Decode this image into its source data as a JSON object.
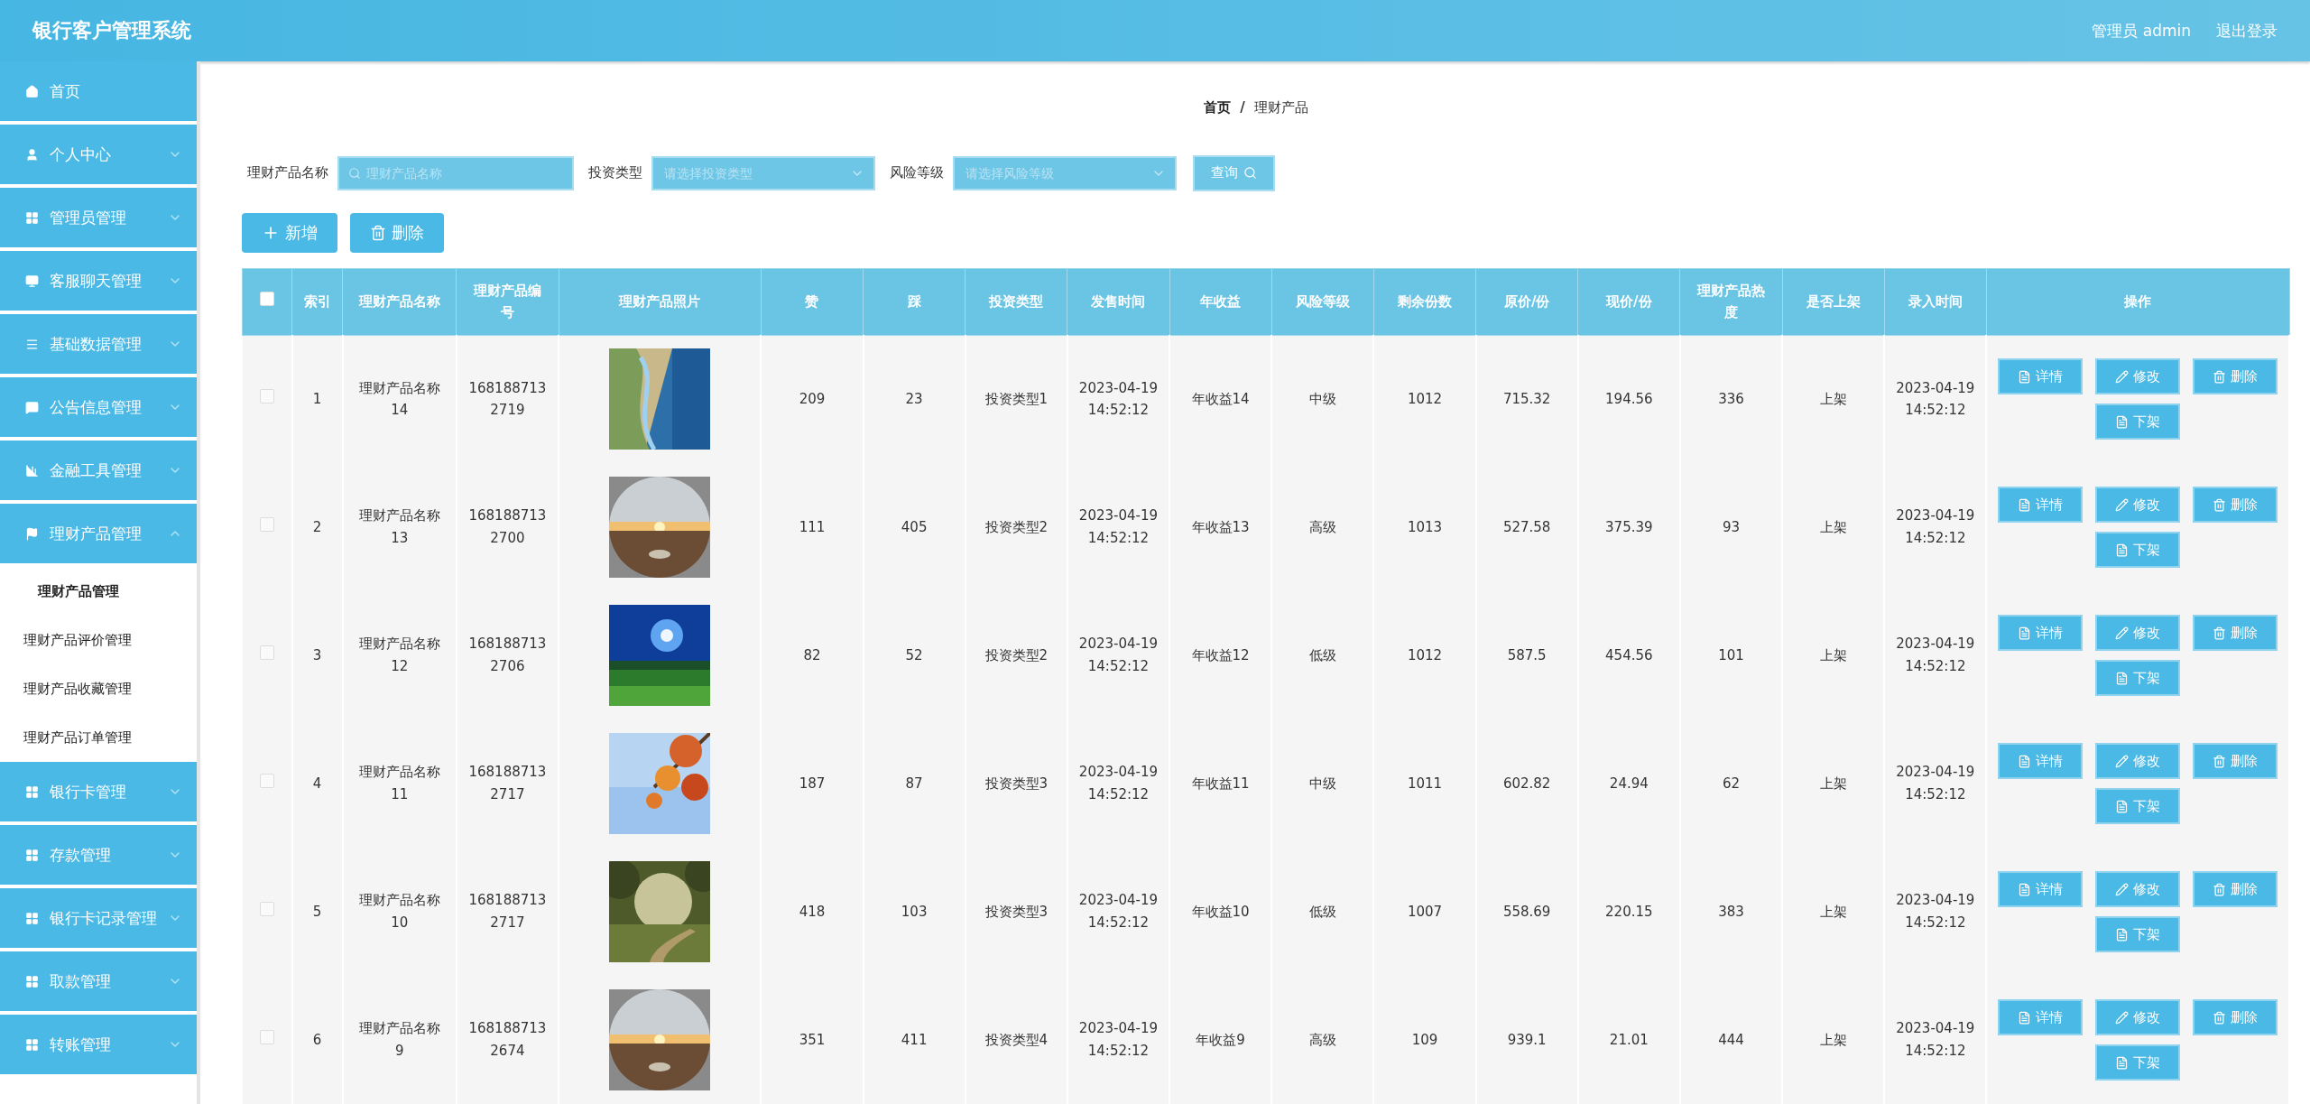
{
  "header": {
    "title": "银行客户管理系统",
    "user": "管理员 admin",
    "logout": "退出登录"
  },
  "sidebar": {
    "items": [
      {
        "label": "首页"
      },
      {
        "label": "个人中心",
        "expanded": false
      },
      {
        "label": "管理员管理",
        "expanded": false
      },
      {
        "label": "客服聊天管理",
        "expanded": false
      },
      {
        "label": "基础数据管理",
        "expanded": false
      },
      {
        "label": "公告信息管理",
        "expanded": false
      },
      {
        "label": "金融工具管理",
        "expanded": false
      },
      {
        "label": "理财产品管理",
        "expanded": true,
        "children": [
          {
            "label": "理财产品管理",
            "selected": true
          },
          {
            "label": "理财产品评价管理",
            "selected": false
          },
          {
            "label": "理财产品收藏管理",
            "selected": false
          },
          {
            "label": "理财产品订单管理",
            "selected": false
          }
        ]
      },
      {
        "label": "银行卡管理",
        "expanded": false
      },
      {
        "label": "存款管理",
        "expanded": false
      },
      {
        "label": "银行卡记录管理",
        "expanded": false
      },
      {
        "label": "取款管理",
        "expanded": false
      },
      {
        "label": "转账管理",
        "expanded": false
      }
    ]
  },
  "breadcrumb": {
    "items": [
      "首页",
      "理财产品"
    ],
    "separator": "/"
  },
  "filters": [
    {
      "kind": "text",
      "label": "理财产品名称",
      "placeholder": "理财产品名称"
    },
    {
      "kind": "select",
      "label": "投资类型",
      "placeholder": "请选择投资类型"
    },
    {
      "kind": "select",
      "label": "风险等级",
      "placeholder": "请选择风险等级"
    }
  ],
  "search_button": "查询",
  "actions": [
    {
      "kind": "add",
      "label": "新增"
    },
    {
      "kind": "delete",
      "label": "删除"
    }
  ],
  "table": {
    "select_all": false,
    "columns": [
      "索引",
      "理财产品名称",
      "理财产品编号",
      "理财产品照片",
      "赞",
      "踩",
      "投资类型",
      "发售时间",
      "年收益",
      "风险等级",
      "剩余份数",
      "原价/份",
      "现价/份",
      "理财产品热度",
      "是否上架",
      "录入时间",
      "操作"
    ],
    "rows": [
      {
        "checked": false,
        "cells": [
          "1",
          "理财产品名称14",
          "1681887132719",
          null,
          "209",
          "23",
          "投资类型1",
          "2023-04-19 14:52:12",
          "年收益14",
          "中级",
          "1012",
          "715.32",
          "194.56",
          "336",
          "上架",
          "2023-04-19 14:52:12"
        ],
        "buttons": [
          {
            "kind": "detail",
            "label": "详情"
          },
          {
            "kind": "edit",
            "label": "修改"
          },
          {
            "kind": "delete",
            "label": "删除"
          },
          {
            "kind": "offshelf",
            "label": "下架"
          }
        ]
      },
      {
        "checked": false,
        "cells": [
          "2",
          "理财产品名称13",
          "1681887132700",
          null,
          "111",
          "405",
          "投资类型2",
          "2023-04-19 14:52:12",
          "年收益13",
          "高级",
          "1013",
          "527.58",
          "375.39",
          "93",
          "上架",
          "2023-04-19 14:52:12"
        ],
        "buttons": [
          {
            "kind": "detail",
            "label": "详情"
          },
          {
            "kind": "edit",
            "label": "修改"
          },
          {
            "kind": "delete",
            "label": "删除"
          },
          {
            "kind": "offshelf",
            "label": "下架"
          }
        ]
      },
      {
        "checked": false,
        "cells": [
          "3",
          "理财产品名称12",
          "1681887132706",
          null,
          "82",
          "52",
          "投资类型2",
          "2023-04-19 14:52:12",
          "年收益12",
          "低级",
          "1012",
          "587.5",
          "454.56",
          "101",
          "上架",
          "2023-04-19 14:52:12"
        ],
        "buttons": [
          {
            "kind": "detail",
            "label": "详情"
          },
          {
            "kind": "edit",
            "label": "修改"
          },
          {
            "kind": "delete",
            "label": "删除"
          },
          {
            "kind": "offshelf",
            "label": "下架"
          }
        ]
      },
      {
        "checked": false,
        "cells": [
          "4",
          "理财产品名称11",
          "1681887132717",
          null,
          "187",
          "87",
          "投资类型3",
          "2023-04-19 14:52:12",
          "年收益11",
          "中级",
          "1011",
          "602.82",
          "24.94",
          "62",
          "上架",
          "2023-04-19 14:52:12"
        ],
        "buttons": [
          {
            "kind": "detail",
            "label": "详情"
          },
          {
            "kind": "edit",
            "label": "修改"
          },
          {
            "kind": "delete",
            "label": "删除"
          },
          {
            "kind": "offshelf",
            "label": "下架"
          }
        ]
      },
      {
        "checked": false,
        "cells": [
          "5",
          "理财产品名称10",
          "1681887132717",
          null,
          "418",
          "103",
          "投资类型3",
          "2023-04-19 14:52:12",
          "年收益10",
          "低级",
          "1007",
          "558.69",
          "220.15",
          "383",
          "上架",
          "2023-04-19 14:52:12"
        ],
        "buttons": [
          {
            "kind": "detail",
            "label": "详情"
          },
          {
            "kind": "edit",
            "label": "修改"
          },
          {
            "kind": "delete",
            "label": "删除"
          },
          {
            "kind": "offshelf",
            "label": "下架"
          }
        ]
      },
      {
        "checked": false,
        "cells": [
          "6",
          "理财产品名称9",
          "1681887132674",
          null,
          "351",
          "411",
          "投资类型4",
          "2023-04-19 14:52:12",
          "年收益9",
          "高级",
          "109",
          "939.1",
          "21.01",
          "444",
          "上架",
          "2023-04-19 14:52:12"
        ],
        "buttons": [
          {
            "kind": "detail",
            "label": "详情"
          },
          {
            "kind": "edit",
            "label": "修改"
          },
          {
            "kind": "delete",
            "label": "删除"
          },
          {
            "kind": "offshelf",
            "label": "下架"
          }
        ]
      }
    ]
  }
}
